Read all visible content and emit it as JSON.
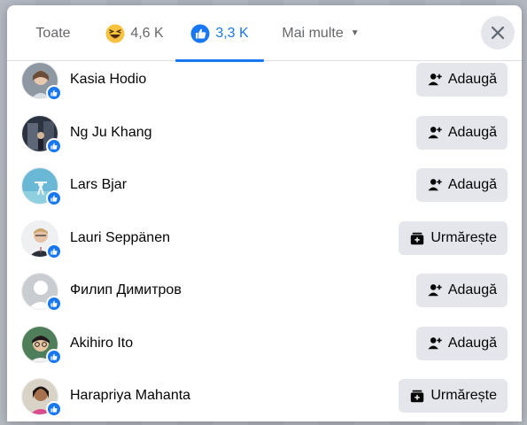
{
  "tabs": [
    {
      "label": "Toate",
      "icon": ""
    },
    {
      "label": "4,6 K",
      "icon": "haha-reaction-icon"
    },
    {
      "label": "3,3 K",
      "icon": "like-reaction-icon"
    },
    {
      "label": "Mai multe",
      "icon": "caret-down-icon"
    }
  ],
  "active_tab": 2,
  "colors": {
    "accent": "#1877f2",
    "button_bg": "#e4e6eb",
    "text": "#050505",
    "muted": "#65676b"
  },
  "people": [
    {
      "name": "Kasia Hodio",
      "action": "Adaugă",
      "action_icon": "add-friend-icon"
    },
    {
      "name": "Ng Ju Khang",
      "action": "Adaugă",
      "action_icon": "add-friend-icon"
    },
    {
      "name": "Lars Bjar",
      "action": "Adaugă",
      "action_icon": "add-friend-icon"
    },
    {
      "name": "Lauri Seppänen",
      "action": "Urmărește",
      "action_icon": "follow-icon"
    },
    {
      "name": "Филип Димитров",
      "action": "Adaugă",
      "action_icon": "add-friend-icon"
    },
    {
      "name": "Akihiro Ito",
      "action": "Adaugă",
      "action_icon": "add-friend-icon"
    },
    {
      "name": "Harapriya Mahanta",
      "action": "Urmărește",
      "action_icon": "follow-icon"
    }
  ]
}
